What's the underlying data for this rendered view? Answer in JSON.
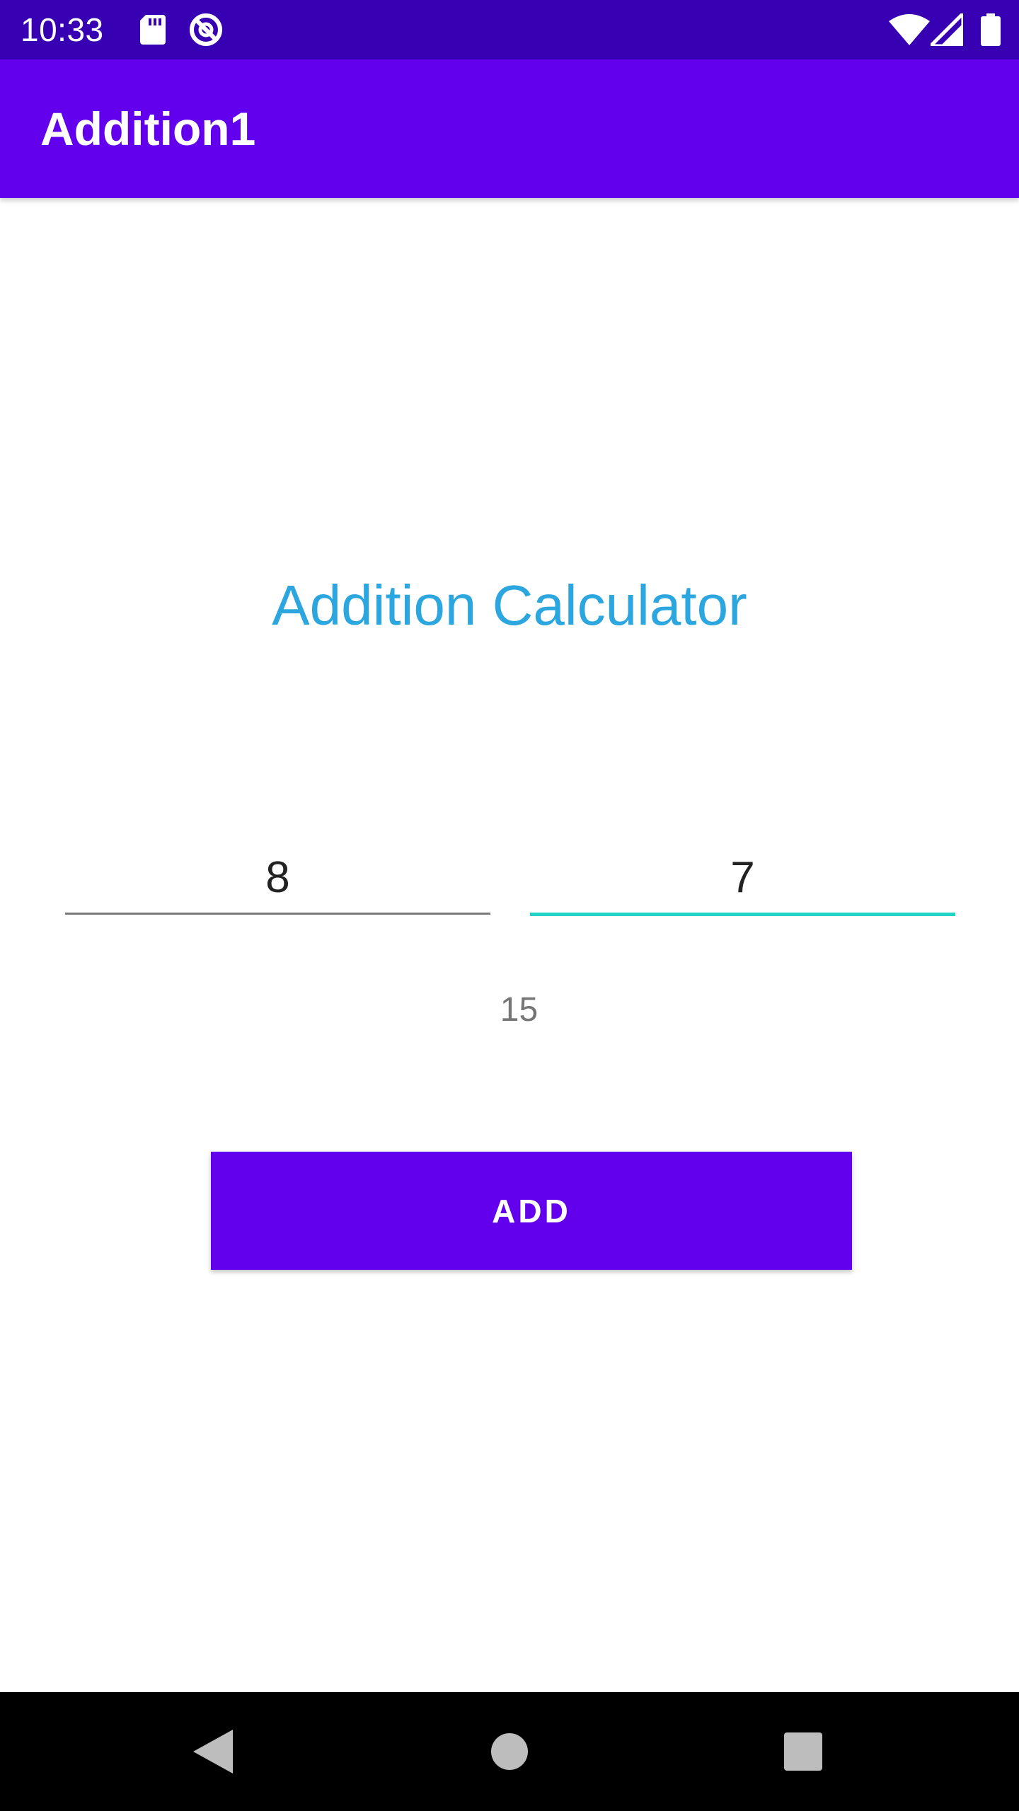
{
  "status_bar": {
    "time": "10:33",
    "icons": [
      "sd-card-icon",
      "sync-blocked-icon",
      "wifi-icon",
      "signal-icon",
      "battery-icon"
    ],
    "background": "#3700B3"
  },
  "app_bar": {
    "title": "Addition1",
    "background": "#6200EE"
  },
  "main": {
    "heading": "Addition Calculator",
    "heading_color": "#2BA6DE",
    "first_number": {
      "value": "8",
      "placeholder": ""
    },
    "second_number": {
      "value": "7",
      "placeholder": "",
      "focused": true,
      "accent": "#1FD4C4"
    },
    "result": "15",
    "add_button_label": "ADD"
  },
  "nav_bar": {
    "icons": [
      "back-icon",
      "home-icon",
      "recents-icon"
    ]
  }
}
